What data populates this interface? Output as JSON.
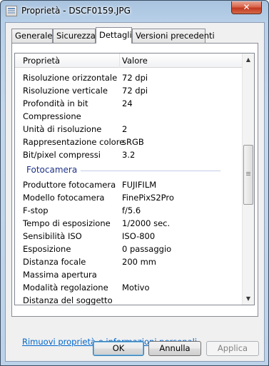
{
  "window": {
    "title": "Proprietà - DSCF0159.JPG",
    "close_label": "✕"
  },
  "tabs": [
    {
      "label": "Generale"
    },
    {
      "label": "Sicurezza"
    },
    {
      "label": "Dettagli"
    },
    {
      "label": "Versioni precedenti"
    }
  ],
  "active_tab": "Dettagli",
  "table": {
    "col_property": "Proprietà",
    "col_value": "Valore",
    "rows_top": [
      {
        "prop": "Risoluzione orizzontale",
        "val": "72 dpi"
      },
      {
        "prop": "Risoluzione verticale",
        "val": "72 dpi"
      },
      {
        "prop": "Profondità in bit",
        "val": "24"
      },
      {
        "prop": "Compressione",
        "val": ""
      },
      {
        "prop": "Unità di risoluzione",
        "val": "2"
      },
      {
        "prop": "Rappresentazione colore",
        "val": "sRGB"
      },
      {
        "prop": "Bit/pixel compressi",
        "val": "3.2"
      }
    ],
    "group": "Fotocamera",
    "rows_camera": [
      {
        "prop": "Produttore fotocamera",
        "val": "FUJIFILM"
      },
      {
        "prop": "Modello fotocamera",
        "val": "FinePixS2Pro"
      },
      {
        "prop": "F-stop",
        "val": "f/5.6"
      },
      {
        "prop": "Tempo di esposizione",
        "val": "1/2000 sec."
      },
      {
        "prop": "Sensibilità ISO",
        "val": "ISO-800"
      },
      {
        "prop": "Esposizione",
        "val": "0 passaggio"
      },
      {
        "prop": "Distanza focale",
        "val": "200 mm"
      },
      {
        "prop": "Massima apertura",
        "val": ""
      },
      {
        "prop": "Modalità regolazione",
        "val": "Motivo"
      },
      {
        "prop": "Distanza del soggetto",
        "val": ""
      }
    ]
  },
  "scrollbar": {
    "up_arrow": "▲",
    "down_arrow": "▼"
  },
  "link_text": "Rimuovi proprietà e informazioni personali",
  "buttons": {
    "ok": "OK",
    "cancel": "Annulla",
    "apply": "Applica"
  }
}
